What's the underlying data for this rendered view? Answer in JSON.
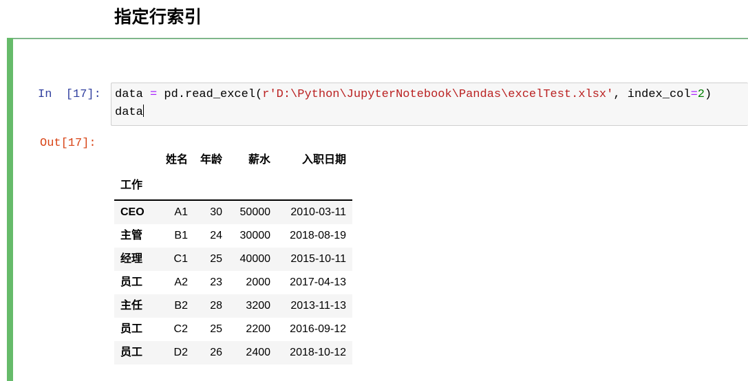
{
  "heading": "指定行索引",
  "cell": {
    "in_prompt": "In  [17]:",
    "out_prompt": "Out[17]:",
    "accent_color": "#66bb6a",
    "in_color": "#303f9f",
    "out_color": "#d84315",
    "code": {
      "line1_a": "data ",
      "line1_op": "=",
      "line1_b": " pd.read_excel(",
      "line1_str": "r'D:\\Python\\JupyterNotebook\\Pandas\\excelTest.xlsx'",
      "line1_c": ", index_col",
      "line1_op2": "=",
      "line1_num": "2",
      "line1_d": ")",
      "line2": "data"
    }
  },
  "dataframe": {
    "index_name": "工作",
    "columns": [
      "姓名",
      "年龄",
      "薪水",
      "入职日期"
    ],
    "rows": [
      {
        "index": "CEO",
        "cells": [
          "A1",
          "30",
          "50000",
          "2010-03-11"
        ]
      },
      {
        "index": "主管",
        "cells": [
          "B1",
          "24",
          "30000",
          "2018-08-19"
        ]
      },
      {
        "index": "经理",
        "cells": [
          "C1",
          "25",
          "40000",
          "2015-10-11"
        ]
      },
      {
        "index": "员工",
        "cells": [
          "A2",
          "23",
          "2000",
          "2017-04-13"
        ]
      },
      {
        "index": "主任",
        "cells": [
          "B2",
          "28",
          "3200",
          "2013-11-13"
        ]
      },
      {
        "index": "员工",
        "cells": [
          "C2",
          "25",
          "2200",
          "2016-09-12"
        ]
      },
      {
        "index": "员工",
        "cells": [
          "D2",
          "26",
          "2400",
          "2018-10-12"
        ]
      }
    ]
  }
}
